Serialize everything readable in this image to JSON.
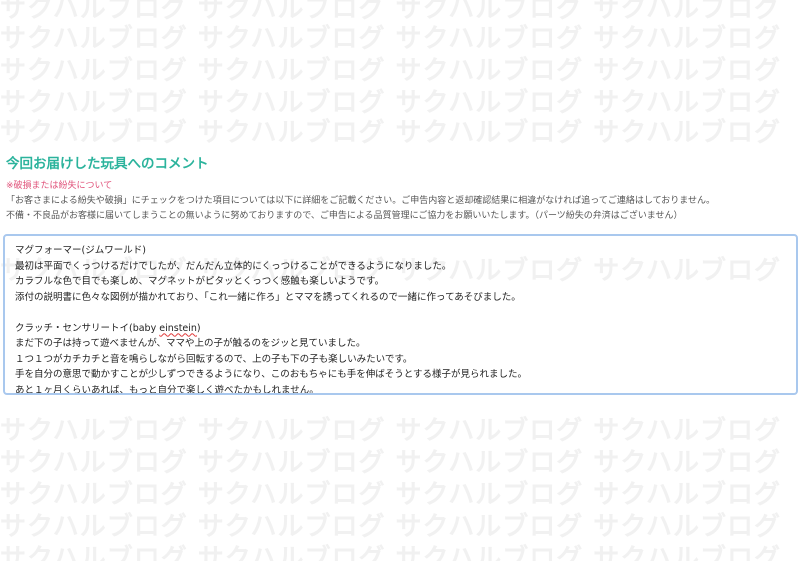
{
  "watermark": {
    "text": "サクハルブログ"
  },
  "section": {
    "title": "今回お届けした玩具へのコメント"
  },
  "note": {
    "heading": "※破損または紛失について",
    "line1": "「お客さまによる紛失や破損」にチェックをつけた項目については以下に詳細をご記載ください。ご申告内容と返却確認結果に相違がなければ追ってご連絡はしておりません。",
    "line2": "不備・不良品がお客様に届いてしまうことの無いように努めておりますので、ご申告による品質管理にご協力をお願いいたします。（パーツ紛失の弁済はございません）"
  },
  "comment": {
    "item1_title": "マグフォーマー(ジムワールド)",
    "item1_line1": "最初は平面でくっつけるだけでしたが、だんだん立体的にくっつけることができるようになりました。",
    "item1_line2": "カラフルな色で目でも楽しめ、マグネットがピタッとくっつく感触も楽しいようです。",
    "item1_line3": "添付の説明書に色々な図例が描かれており、「これ一緒に作ろ」とママを誘ってくれるので一緒に作ってあそびました。",
    "item2_title_prefix": "クラッチ・センサリートイ(baby ",
    "item2_title_spell": "einstein",
    "item2_title_suffix": ")",
    "item2_line1": "まだ下の子は持って遊べませんが、ママや上の子が触るのをジッと見ていました。",
    "item2_line2": "１つ１つがカチカチと音を鳴らしながら回転するので、上の子も下の子も楽しいみたいです。",
    "item2_line3": "手を自分の意思で動かすことが少しずつできるようになり、このおもちゃにも手を伸ばそうとする様子が見られました。",
    "item2_line4": "あと１ヶ月くらいあれば、もっと自分で楽しく遊べたかもしれません。"
  }
}
